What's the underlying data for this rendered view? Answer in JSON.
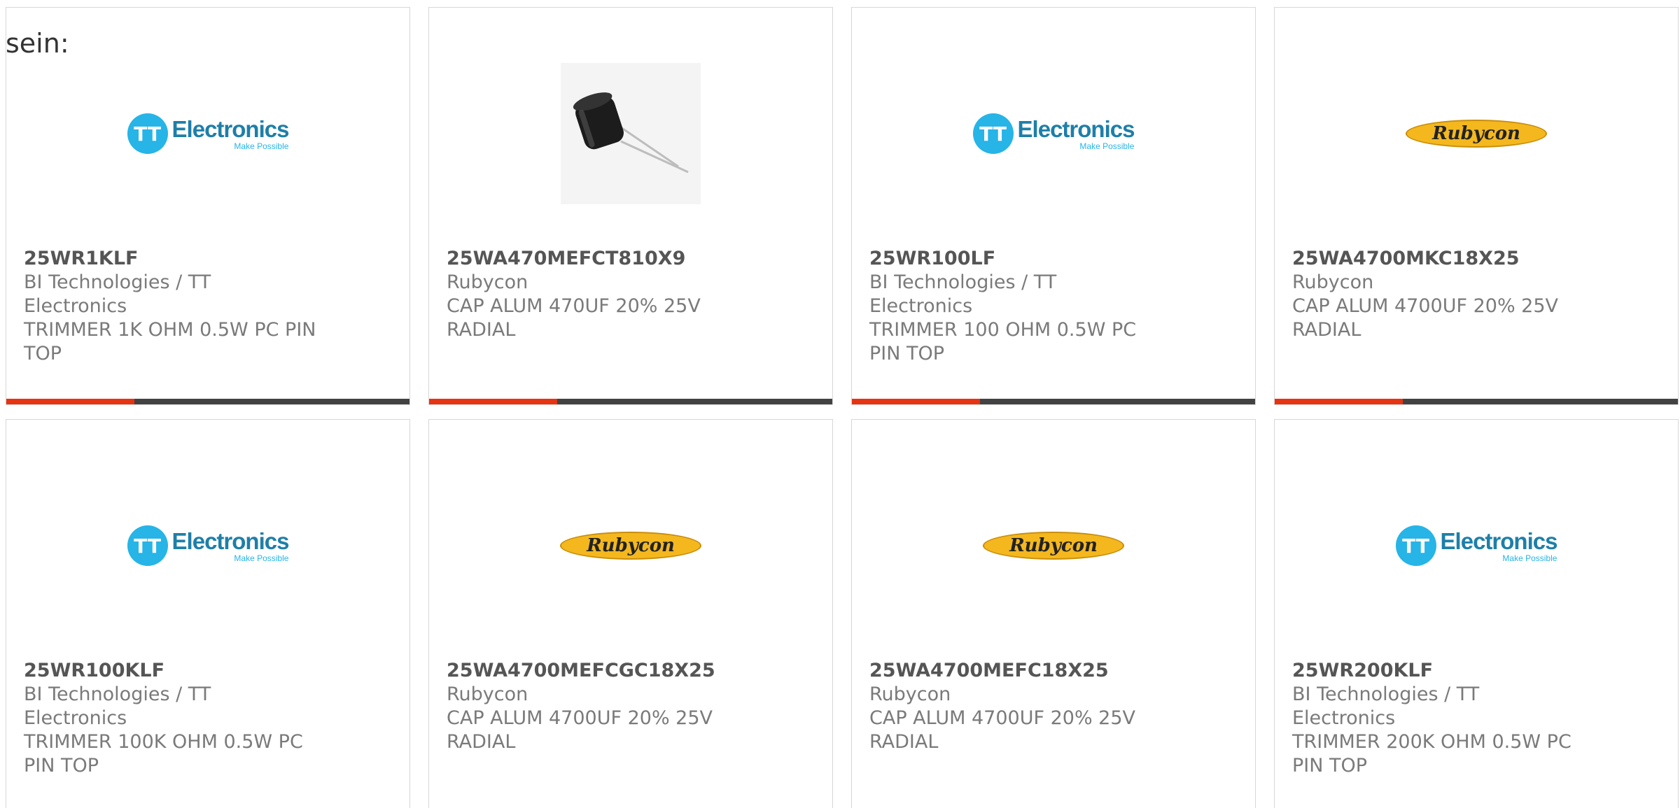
{
  "intro": {
    "text": "sein:"
  },
  "logos": {
    "tt": {
      "mark": "TT",
      "name": "Electronics",
      "tagline": "Make Possible"
    },
    "rubycon": {
      "name": "Rubycon"
    }
  },
  "colors": {
    "accent": "#e63312",
    "bar": "#424242",
    "tt_blue": "#27b4e6",
    "rubycon_yellow": "#f4b81e"
  },
  "products": [
    {
      "part_number": "25WR1KLF",
      "manufacturer": "BI Technologies / TT Electronics",
      "description": "TRIMMER 1K OHM 0.5W PC PIN TOP",
      "image": "tt-electronics-logo"
    },
    {
      "part_number": "25WA470MEFCT810X9",
      "manufacturer": "Rubycon",
      "description": "CAP ALUM 470UF 20% 25V RADIAL",
      "image": "capacitor-photo"
    },
    {
      "part_number": "25WR100LF",
      "manufacturer": "BI Technologies / TT Electronics",
      "description": "TRIMMER 100 OHM 0.5W PC PIN TOP",
      "image": "tt-electronics-logo"
    },
    {
      "part_number": "25WA4700MKC18X25",
      "manufacturer": "Rubycon",
      "description": "CAP ALUM 4700UF 20% 25V RADIAL",
      "image": "rubycon-logo"
    },
    {
      "part_number": "25WR100KLF",
      "manufacturer": "BI Technologies / TT Electronics",
      "description": "TRIMMER 100K OHM 0.5W PC PIN TOP",
      "image": "tt-electronics-logo"
    },
    {
      "part_number": "25WA4700MEFCGC18X25",
      "manufacturer": "Rubycon",
      "description": "CAP ALUM 4700UF 20% 25V RADIAL",
      "image": "rubycon-logo"
    },
    {
      "part_number": "25WA4700MEFC18X25",
      "manufacturer": "Rubycon",
      "description": "CAP ALUM 4700UF 20% 25V RADIAL",
      "image": "rubycon-logo"
    },
    {
      "part_number": "25WR200KLF",
      "manufacturer": "BI Technologies / TT Electronics",
      "description": "TRIMMER 200K OHM 0.5W PC PIN TOP",
      "image": "tt-electronics-logo"
    }
  ]
}
